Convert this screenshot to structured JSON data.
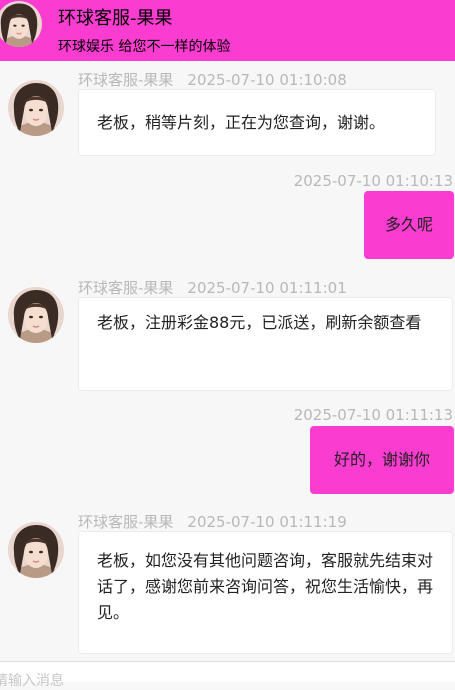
{
  "header": {
    "title": "环球客服-果果",
    "subtitle": "环球娱乐 给您不一样的体验"
  },
  "messages": [
    {
      "side": "left",
      "sender": "环球客服-果果",
      "time": "2025-07-10 01:10:08",
      "text": "老板，稍等片刻，正在为您查询，谢谢。"
    },
    {
      "side": "right",
      "time": "2025-07-10 01:10:13",
      "text": "多久呢"
    },
    {
      "side": "left",
      "sender": "环球客服-果果",
      "time": "2025-07-10 01:11:01",
      "text": "老板，注册彩金88元，已派送，刷新余额查看"
    },
    {
      "side": "right",
      "time": "2025-07-10 01:11:13",
      "text": "好的，谢谢你"
    },
    {
      "side": "left",
      "sender": "环球客服-果果",
      "time": "2025-07-10 01:11:19",
      "text": "老板，如您没有其他问题咨询，客服就先结束对话了，感谢您前来咨询问答，祝您生活愉快，再见。"
    }
  ],
  "input": {
    "placeholder": "请输入消息"
  },
  "colors": {
    "accent": "#fb3cd0",
    "background": "#f7f7f7",
    "bubble": "#ffffff",
    "meta_text": "#b8b8b8"
  },
  "icons": {
    "avatar": "agent-avatar-icon"
  }
}
